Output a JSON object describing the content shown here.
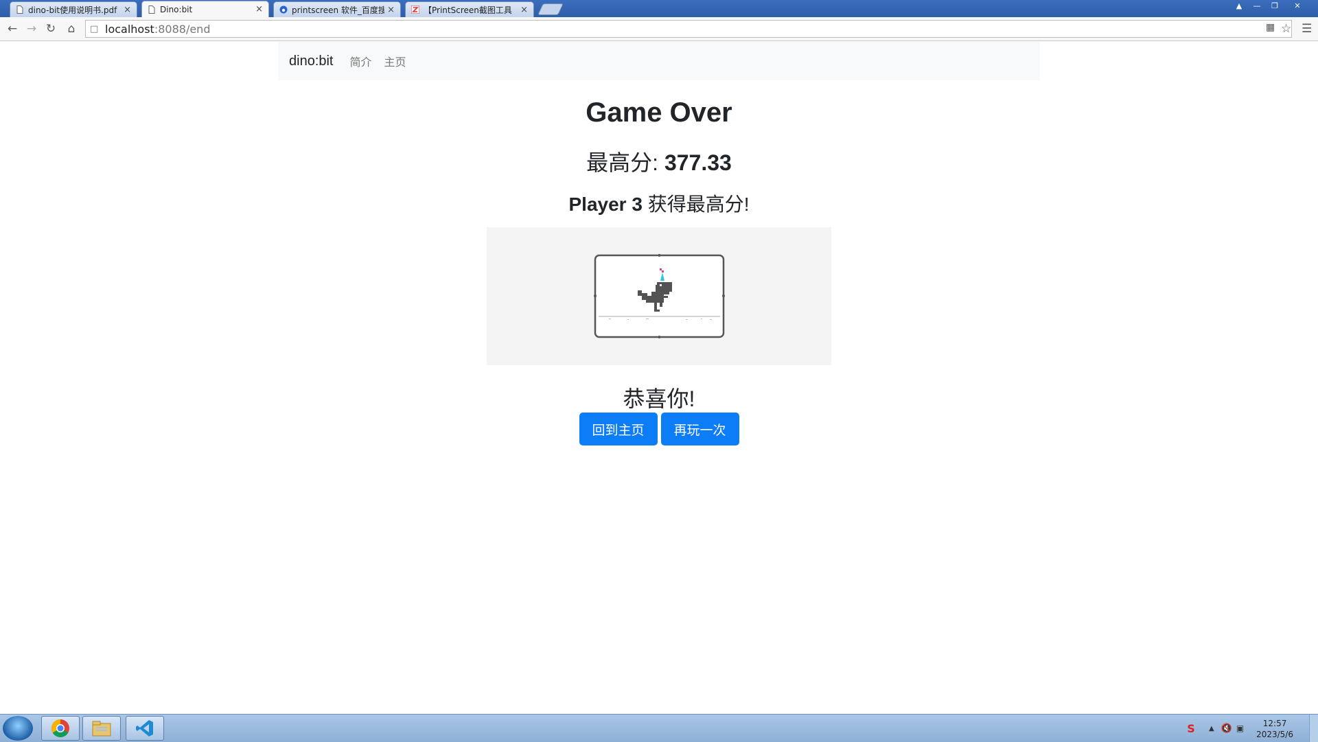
{
  "browser": {
    "tabs": [
      {
        "title": "dino-bit使用说明书.pdf",
        "icon": "document-icon",
        "active": false
      },
      {
        "title": "Dino:bit",
        "icon": "document-icon",
        "active": true
      },
      {
        "title": "printscreen 软件_百度搜",
        "icon": "baidu-icon",
        "active": false
      },
      {
        "title": "【PrintScreen截图工具",
        "icon": "zhihu-icon",
        "active": false
      }
    ],
    "url_host": "localhost",
    "url_rest": ":8088/end"
  },
  "nav": {
    "brand": "dino:bit",
    "links": [
      "简介",
      "主页"
    ]
  },
  "main": {
    "title": "Game Over",
    "score_label": "最高分: ",
    "score_value": "377.33",
    "player_name": "Player 3",
    "player_suffix": " 获得最高分!",
    "congrats": "恭喜你!",
    "home_button": "回到主页",
    "replay_button": "再玩一次"
  },
  "taskbar": {
    "time": "12:57",
    "date": "2023/5/6"
  },
  "colors": {
    "accent": "#0d7cf7",
    "navbar_bg": "#f8f9fa",
    "game_bg": "#f4f4f4"
  }
}
